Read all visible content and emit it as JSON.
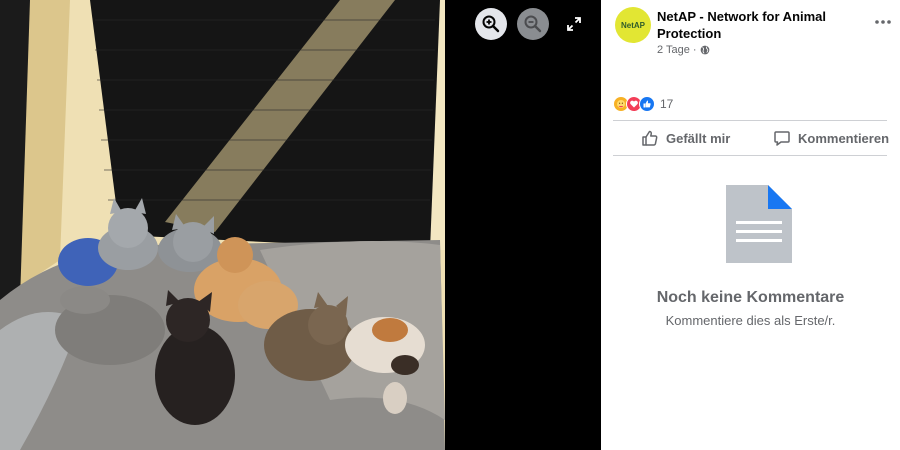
{
  "viewer": {
    "zoom_in_icon": "zoom-in-icon",
    "zoom_out_icon": "zoom-out-icon",
    "fullscreen_icon": "fullscreen-icon",
    "photo_subject": "kittens-photo"
  },
  "post": {
    "page_name": "NetAP - Network for Animal Protection",
    "avatar_text": "NetAP",
    "time": "2 Tage",
    "separator": "·",
    "audience_icon": "globe-icon",
    "more_icon": "more-options-icon"
  },
  "reactions": {
    "icons": [
      "care-icon",
      "love-icon",
      "like-icon"
    ],
    "count": "17"
  },
  "actions": {
    "like_label": "Gefällt mir",
    "comment_label": "Kommentieren"
  },
  "comments": {
    "empty_title": "Noch keine Kommentare",
    "empty_subtitle": "Kommentiere dies als Erste/r."
  },
  "colors": {
    "accent": "#1877f2",
    "love": "#f33e58",
    "care": "#f7b125",
    "secondary_text": "#65676b",
    "avatar_bg": "#e2e633"
  }
}
